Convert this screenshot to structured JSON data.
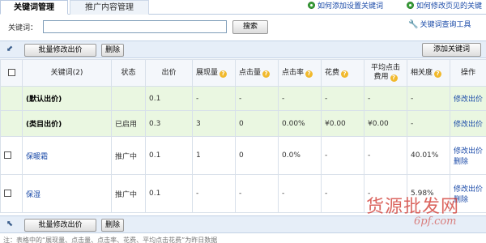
{
  "tabs": [
    {
      "label": "关键词管理"
    },
    {
      "label": "推广内容管理"
    }
  ],
  "top_links": [
    {
      "label": "如何添加设置关键词"
    },
    {
      "label": "如何修改页见的关键"
    }
  ],
  "search": {
    "label": "关键词：",
    "value": "",
    "placeholder": "",
    "button_label": "搜索"
  },
  "tool_link": {
    "label": "关键词查询工具"
  },
  "toolbar": {
    "batch_label": "批量修改出价",
    "delete_label": "删除",
    "add_label": "添加关键词"
  },
  "table": {
    "headers": [
      "",
      "关键词(2)",
      "状态",
      "出价",
      "展现量",
      "点击量",
      "点击率",
      "花费",
      "平均点击费用",
      "相关度",
      "操作"
    ],
    "headers_with_help": [
      4,
      5,
      6,
      7,
      8,
      9
    ],
    "rows": [
      {
        "checkbox": false,
        "keyword": "(默认出价)",
        "status": "",
        "bid": "0.1",
        "impressions": "-",
        "clicks": "-",
        "ctr": "-",
        "cost": "-",
        "avg_cpc": "-",
        "relevance": "-",
        "action": "修改出价"
      },
      {
        "checkbox": false,
        "keyword": "(类目出价)",
        "status": "已启用",
        "bid": "0.3",
        "impressions": "3",
        "clicks": "0",
        "ctr": "0.00%",
        "cost": "¥0.00",
        "avg_cpc": "¥0.00",
        "relevance": "-",
        "action": "修改出价"
      },
      {
        "checkbox": true,
        "keyword": "保暖霜",
        "status": "推广中",
        "bid": "0.1",
        "impressions": "1",
        "clicks": "0",
        "ctr": "0.0%",
        "cost": "-",
        "avg_cpc": "-",
        "relevance": "40.01%",
        "action": "修改出价",
        "action2": "删除"
      },
      {
        "checkbox": true,
        "keyword": "保湿",
        "status": "推广中",
        "bid": "0.1",
        "impressions": "-",
        "clicks": "-",
        "ctr": "-",
        "cost": "-",
        "avg_cpc": "-",
        "relevance": "5.98%",
        "action": "修改出价",
        "action2": "删除"
      }
    ]
  },
  "note": "注：表格中的“展现量、点击量、点击率、花费、平均点击花费”为昨日数据",
  "watermark": {
    "text": "货源批发网",
    "url": "6pf.com"
  },
  "colors": {
    "accent_link": "#1a4aa8",
    "highlight_row": "#eaf7e1",
    "toolbar": "#e6eef8",
    "help_icon": "#f1b92c"
  }
}
